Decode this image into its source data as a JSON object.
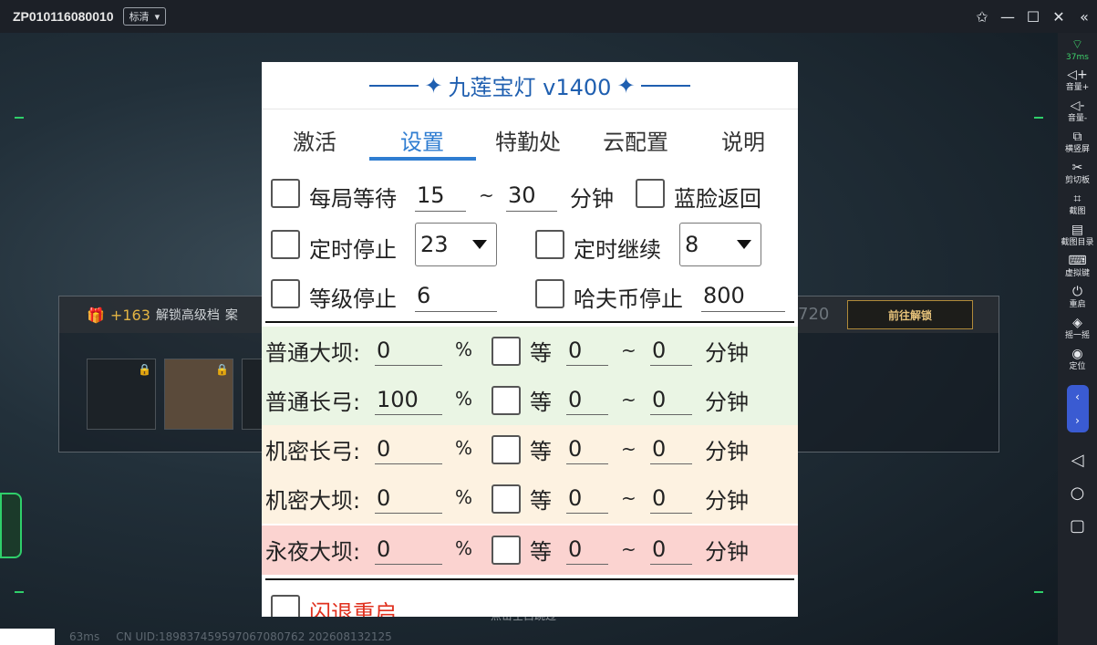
{
  "window": {
    "title": "ZP010116080010",
    "quality": "标清"
  },
  "game": {
    "panel_plus": "+163",
    "panel_unlock_text": "解锁高级档",
    "panel_partial": "案",
    "panel_number": "720",
    "goto_unlock": "前往解锁",
    "skip_text": "点击空白跳过",
    "ping": "63ms",
    "uid": "CN UID:18983745959706708076​2 202608132125"
  },
  "sidebar": {
    "latency": "37ms",
    "items": [
      {
        "icon": "volume-up-icon",
        "label": "音量+"
      },
      {
        "icon": "volume-down-icon",
        "label": "音量-"
      },
      {
        "icon": "rotate-screen-icon",
        "label": "横竖屏"
      },
      {
        "icon": "scissors-icon",
        "label": "剪切板"
      },
      {
        "icon": "crop-icon",
        "label": "截图"
      },
      {
        "icon": "screenshot-list-icon",
        "label": "截图目录"
      },
      {
        "icon": "keyboard-icon",
        "label": "虚拟键"
      },
      {
        "icon": "power-icon",
        "label": "重启"
      },
      {
        "icon": "shake-icon",
        "label": "摇一摇"
      },
      {
        "icon": "location-icon",
        "label": "定位"
      }
    ]
  },
  "dialog": {
    "title": "九莲宝灯 v1400",
    "tabs": [
      "激活",
      "设置",
      "特勤处",
      "云配置",
      "说明"
    ],
    "active_tab": "设置",
    "row1": {
      "label": "每局等待",
      "min": "15",
      "tilde": "~",
      "max": "30",
      "unit": "分钟",
      "blue_face_label": "蓝脸返回"
    },
    "row2": {
      "stop_label": "定时停止",
      "stop_value": "23",
      "continue_label": "定时继续",
      "continue_value": "8"
    },
    "row3": {
      "level_label": "等级停止",
      "level_value": "6",
      "coin_label": "哈夫币停止",
      "coin_value": "800"
    },
    "maps": [
      {
        "name": "普通大坝:",
        "value": "0",
        "pct": "%",
        "wait": "等",
        "min": "0",
        "tilde": "~",
        "max": "0",
        "unit": "分钟",
        "bg": "#eaf5e4"
      },
      {
        "name": "普通长弓:",
        "value": "100",
        "pct": "%",
        "wait": "等",
        "min": "0",
        "tilde": "~",
        "max": "0",
        "unit": "分钟",
        "bg": "#eaf5e4"
      },
      {
        "name": "机密长弓:",
        "value": "0",
        "pct": "%",
        "wait": "等",
        "min": "0",
        "tilde": "~",
        "max": "0",
        "unit": "分钟",
        "bg": "#fdf2e1"
      },
      {
        "name": "机密大坝:",
        "value": "0",
        "pct": "%",
        "wait": "等",
        "min": "0",
        "tilde": "~",
        "max": "0",
        "unit": "分钟",
        "bg": "#fdf2e1"
      },
      {
        "name": "永夜大坝:",
        "value": "0",
        "pct": "%",
        "wait": "等",
        "min": "0",
        "tilde": "~",
        "max": "0",
        "unit": "分钟",
        "bg": "#fbd3d0"
      }
    ],
    "crash_restart_label": "闪退重启"
  }
}
